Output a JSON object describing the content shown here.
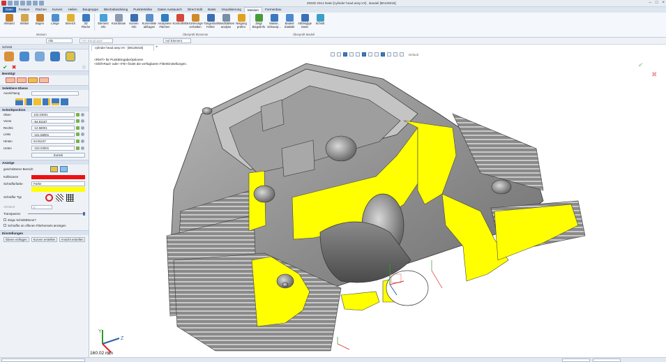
{
  "titlebar": {
    "title": "ZW3D 2014          Datei [cylinder head assy.VX] ,  Bauteil [80125018]"
  },
  "menu": {
    "tabs": [
      "Datei",
      "Feature",
      "Flächen",
      "Kurven",
      "Heilen",
      "Baugruppe",
      "Blechabwicklung",
      "PunkteWolke",
      "Daten Austausch",
      "Direct Edit",
      "Basis",
      "Visualisierung",
      "Messen",
      "Formenbau"
    ]
  },
  "ribbon": {
    "items": [
      {
        "label": "Abstand",
        "color": "#c8802a"
      },
      {
        "label": "Winkel",
        "color": "#d4a54a"
      },
      {
        "label": "Bogen",
        "color": "#c8802a"
      },
      {
        "label": "Länge",
        "color": "#4f8fd0"
      },
      {
        "label": "Bereich",
        "color": "#e0b030"
      },
      {
        "label": "3D\nFläche",
        "color": "#3a78c0"
      },
      {
        "label": "Element\nInfo",
        "color": "#4aa0d8"
      },
      {
        "label": "Koordinate",
        "color": "#8a9ab0"
      },
      {
        "label": "Kurven\nInfo",
        "color": "#3c6fb0"
      },
      {
        "label": "Kurvenliste\nabfragen",
        "color": "#5a8fc8"
      },
      {
        "label": "Analysiere\nFlächen",
        "color": "#2f7fc0"
      },
      {
        "label": "Kontrollinfo",
        "color": "#d24a3a"
      },
      {
        "label": "Krümmungs-\nverhalten",
        "color": "#d08a2a"
      },
      {
        "label": "Tangential\nFehler",
        "color": "#3a6fb0"
      },
      {
        "label": "Wandstärken\nanalyse",
        "color": "#7a8ea8"
      },
      {
        "label": "Neigung\nprüfen",
        "color": "#e0a020"
      },
      {
        "label": "Zeigt\nBiegelinfo",
        "color": "#4a9a3a"
      },
      {
        "label": "Masse,\nSchwerp...",
        "color": "#3c78c0"
      },
      {
        "label": "Bauteil\nStatistik",
        "color": "#4a8ad0"
      },
      {
        "label": "Abhängige\nDatei",
        "color": "#3a70b8"
      },
      {
        "label": "Schnitt",
        "color": "#3aa0c8"
      }
    ],
    "groups": [
      "Messen",
      "Überprüft Elemente",
      "Überprüft Modell"
    ]
  },
  "filterbar": {
    "filter_value": "Alle",
    "assembly_placeholder": "Von Baugruppe",
    "pick_mode": "Auf Element"
  },
  "panel": {
    "title": "Schnitt",
    "sections": {
      "required": "Benötigt",
      "select_plane": "Selektiere Ebene",
      "section_position": "Schnittposition",
      "display": "Anzeige",
      "settings": "Einstellungen"
    },
    "orientation_label": "Ausrichtung",
    "positions": [
      {
        "label": "Oben",
        "value": "102.03001"
      },
      {
        "label": "Vorne",
        "value": "-94.81157"
      },
      {
        "label": "Rechts",
        "value": "-12.58001"
      },
      {
        "label": "Links",
        "value": "-101.58001"
      },
      {
        "label": "Hinten",
        "value": "64.81157"
      },
      {
        "label": "Unten",
        "value": "-102.03001"
      }
    ],
    "reset_button": "Zurück",
    "cut_area_label": "geschnittener Bereich",
    "collisions_label": "Kollisionen",
    "collision_color": "#ee1111",
    "hatch_color_label": "Schraffurfarbe",
    "hatch_color_value": "Farbe",
    "hatch_color": "#ffff00",
    "hatch_type_label": "Schraffur Typ",
    "spacing_label": "Abstand",
    "spacing_value": "5",
    "transparency_label": "Transparenz",
    "show_plane_label": "Zeige SchnittEbene?",
    "hatch_open_label": "Schraffur an offenen Flächensets anzeigen",
    "buttons": [
      "Ebene einfügen",
      "Kurven erstellen",
      "Ansicht erstellen"
    ]
  },
  "document": {
    "tab": "cylinder head assy.VX - [80125018]"
  },
  "viewport": {
    "hint1": "<RMT> für PunktEingabeOptionen",
    "hint2": "<Shift-Rad> oder <F8> findet die verfügbaren FilterEinstellungen.",
    "view_default": "Default",
    "scale": "160.02 mm",
    "triad_labels": [
      "Y",
      "Z",
      "X"
    ]
  },
  "colors": {
    "accent": "#2b62a8",
    "section_fill": "#ffff00",
    "model": "#9a9a9a"
  }
}
